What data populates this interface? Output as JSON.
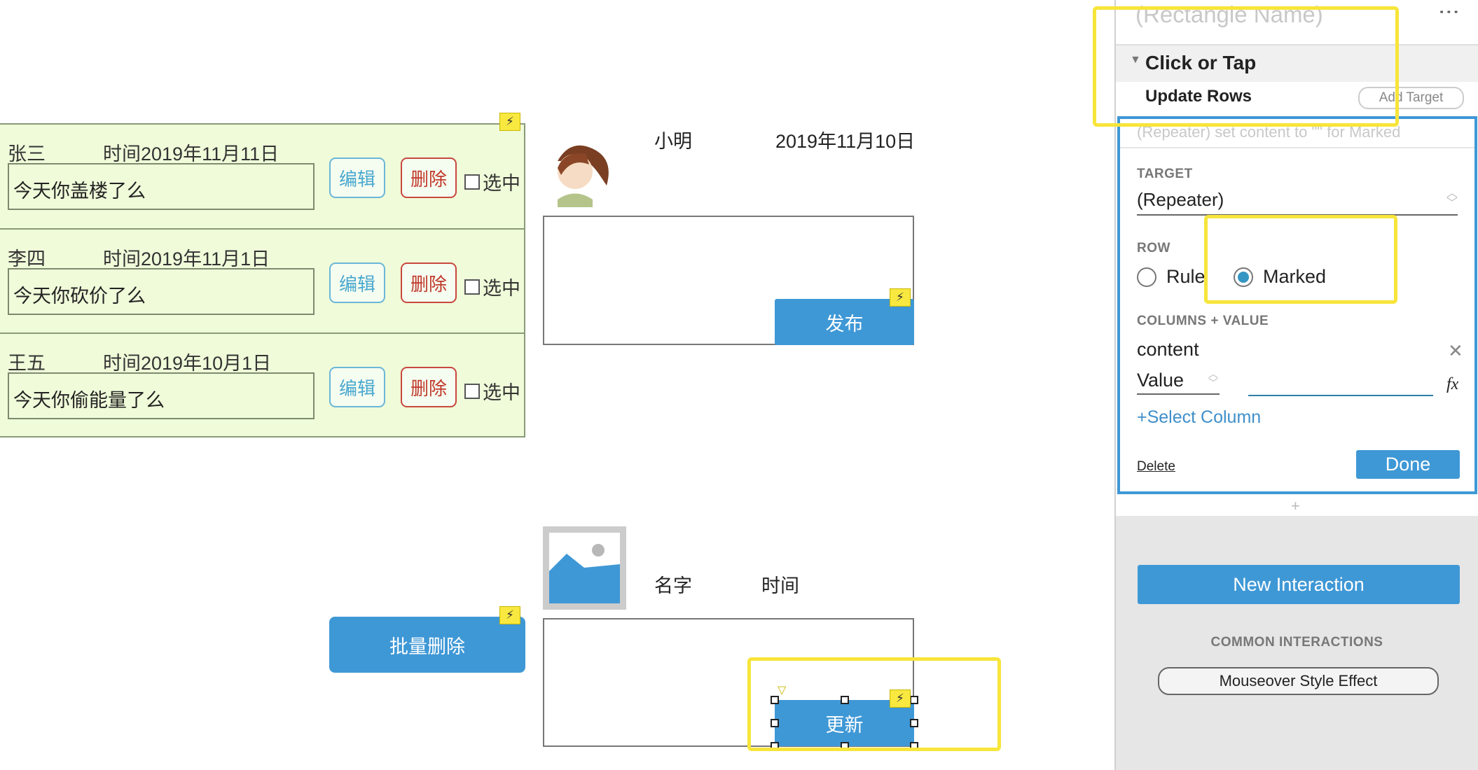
{
  "repeater": {
    "rows": [
      {
        "name": "张三",
        "time": "时间2019年11月11日",
        "content": "今天你盖楼了么",
        "edit": "编辑",
        "delete": "删除",
        "select": "选中"
      },
      {
        "name": "李四",
        "time": "时间2019年11月1日",
        "content": "今天你砍价了么",
        "edit": "编辑",
        "delete": "删除",
        "select": "选中"
      },
      {
        "name": "王五",
        "time": "时间2019年10月1日",
        "content": "今天你偷能量了么",
        "edit": "编辑",
        "delete": "删除",
        "select": "选中"
      }
    ]
  },
  "post": {
    "name": "小明",
    "date": "2019年11月10日",
    "publish": "发布"
  },
  "edit_form": {
    "name": "名字",
    "time": "时间",
    "update": "更新"
  },
  "batch_delete": "批量删除",
  "panel": {
    "widget_name_placeholder": "(Rectangle Name)",
    "event": "Click or Tap",
    "action": "Update Rows",
    "add_target": "Add Target",
    "summary": "(Repeater) set content to \"\" for Marked",
    "target_label": "TARGET",
    "target_value": "(Repeater)",
    "row_label": "ROW",
    "row_options": [
      "Rule",
      "Marked"
    ],
    "row_selected": "Marked",
    "columns_label": "COLUMNS + VALUE",
    "column_name": "content",
    "value_type": "Value",
    "value_input": "",
    "fx": "fx",
    "select_column": "+Select Column",
    "delete": "Delete",
    "done": "Done",
    "plus": "+",
    "new_interaction": "New Interaction",
    "common_label": "COMMON INTERACTIONS",
    "mouseover": "Mouseover Style Effect"
  },
  "colors": {
    "accent": "#3f98d6",
    "highlight": "#f7e53a",
    "repeater_bg": "#effbd9",
    "delete_red": "#c0392b"
  }
}
